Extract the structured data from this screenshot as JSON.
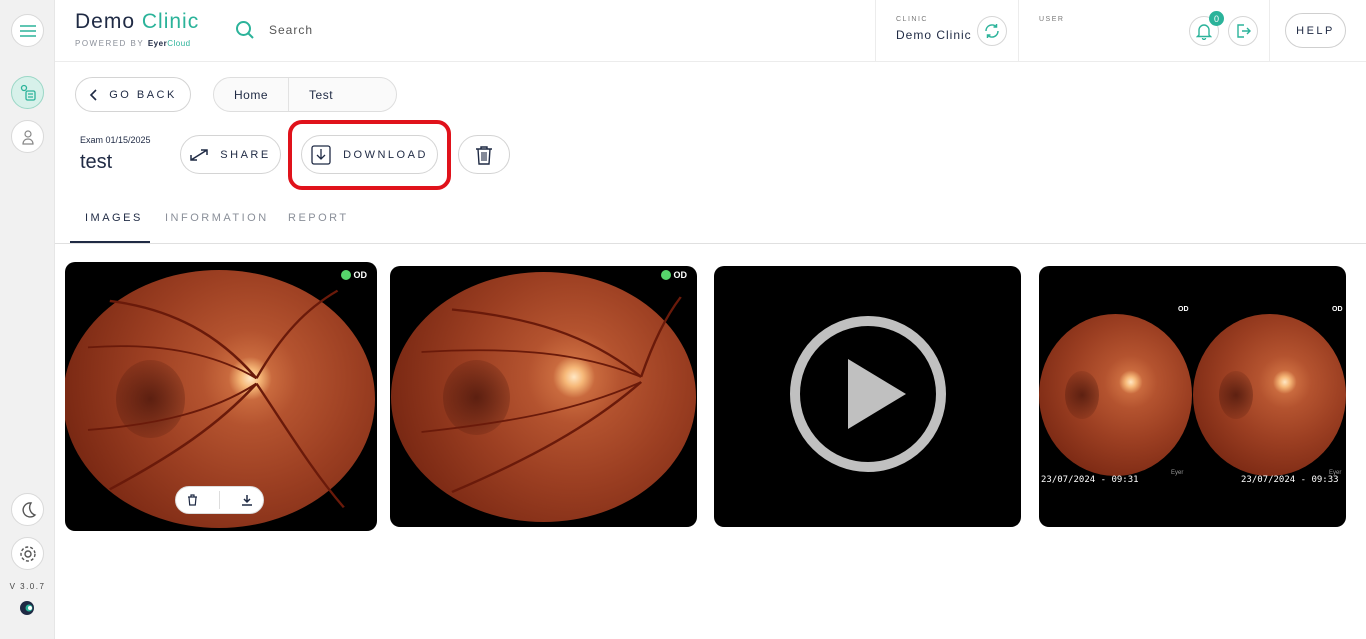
{
  "app": {
    "brand_primary": "Demo",
    "brand_accent": "Clinic",
    "powered_by_label": "POWERED BY",
    "powered_by_brand": "Eyer",
    "powered_by_brand_accent": "Cloud",
    "version": "V 3.0.7",
    "accent_color": "#2bb39a"
  },
  "header": {
    "search_placeholder": "Search",
    "clinic_label": "CLINIC",
    "clinic_name": "Demo Clinic",
    "user_label": "USER",
    "notification_count": "0",
    "help_label": "HELP"
  },
  "actions": {
    "go_back_label": "GO BACK",
    "share_label": "SHARE",
    "download_label": "DOWNLOAD"
  },
  "breadcrumb": [
    "Home",
    "Test"
  ],
  "exam": {
    "date_label": "Exam 01/15/2025",
    "name": "test"
  },
  "tabs": [
    "IMAGES",
    "INFORMATION",
    "REPORT"
  ],
  "images": [
    {
      "eye": "OD",
      "type": "retina"
    },
    {
      "eye": "OD",
      "type": "retina"
    },
    {
      "type": "video"
    },
    {
      "type": "comparison",
      "left_eye": "OD",
      "right_eye": "OD",
      "left_timestamp": "23/07/2024 - 09:31",
      "right_timestamp": "23/07/2024 - 09:33",
      "watermark": "Eyer"
    }
  ],
  "icons": {
    "menu": "menu-icon",
    "exams": "exam-list-icon",
    "patients": "user-icon",
    "theme": "moon-icon",
    "settings": "gear-icon",
    "search": "search-icon",
    "sync": "sync-icon",
    "bell": "bell-icon",
    "logout": "logout-icon",
    "back": "chevron-left-icon",
    "share": "expand-arrows-icon",
    "download": "download-icon",
    "delete": "trash-icon",
    "play": "play-icon"
  },
  "colors": {
    "highlight": "#e0121b",
    "od_dot": "#56d66b"
  }
}
